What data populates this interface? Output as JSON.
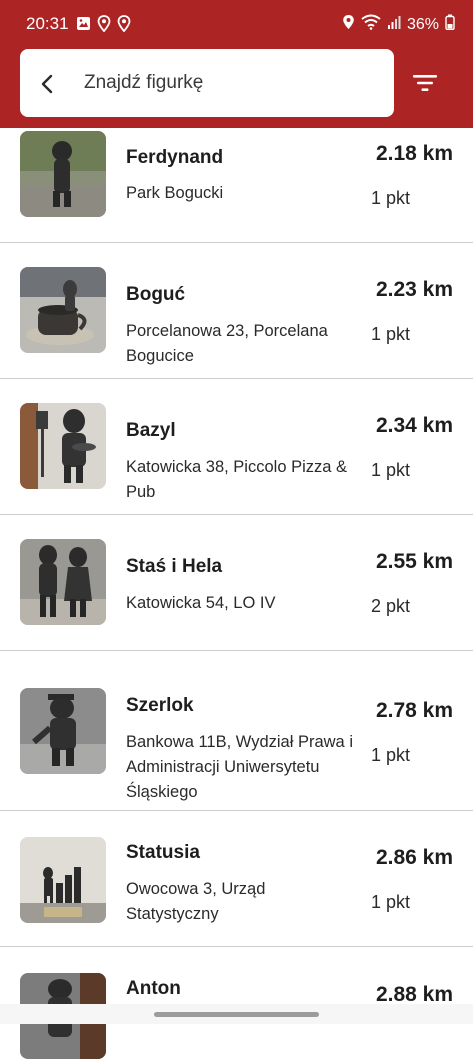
{
  "status_bar": {
    "time": "20:31",
    "battery": "36%",
    "left_icons": [
      "image-icon",
      "location-pin-icon",
      "location-pin-icon"
    ],
    "right_icons": [
      "location-icon",
      "wifi-icon",
      "signal-icon",
      "battery-icon"
    ]
  },
  "search": {
    "placeholder": "Znajdź figurkę",
    "value": ""
  },
  "colors": {
    "header": "#ad2424",
    "background": "#ffffff",
    "divider": "#cccccc"
  },
  "items": [
    {
      "name": "Ferdynand",
      "address": "Park Bogucki",
      "distance": "2.18 km",
      "points": "1 pkt"
    },
    {
      "name": "Boguć",
      "address": "Porcelanowa 23, Porcelana Bogucice",
      "distance": "2.23 km",
      "points": "1 pkt"
    },
    {
      "name": "Bazyl",
      "address": "Katowicka 38, Piccolo Pizza & Pub",
      "distance": "2.34 km",
      "points": "1 pkt"
    },
    {
      "name": "Staś i Hela",
      "address": "Katowicka 54, LO IV",
      "distance": "2.55 km",
      "points": "2 pkt"
    },
    {
      "name": "Szerlok",
      "address": "Bankowa 11B, Wydział Prawa i Administracji Uniwersytetu Śląskiego",
      "distance": "2.78 km",
      "points": "1 pkt"
    },
    {
      "name": "Statusia",
      "address": "Owocowa 3, Urząd Statystyczny",
      "distance": "2.86 km",
      "points": "1 pkt"
    },
    {
      "name": "Anton",
      "address": "",
      "distance": "2.88 km",
      "points": ""
    }
  ]
}
